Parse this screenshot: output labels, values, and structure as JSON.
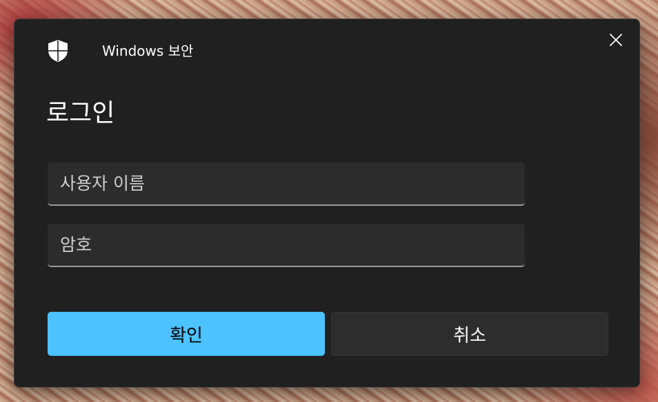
{
  "dialog": {
    "app_title": "Windows 보안",
    "heading": "로그인",
    "fields": {
      "username": {
        "placeholder": "사용자 이름",
        "value": ""
      },
      "password": {
        "placeholder": "암호",
        "value": ""
      }
    },
    "buttons": {
      "ok_label": "확인",
      "cancel_label": "취소"
    },
    "icons": {
      "app": "shield-icon",
      "close": "close-icon"
    }
  },
  "colors": {
    "dialog_bg": "#202020",
    "field_bg": "#2c2c2c",
    "accent": "#4cc2ff",
    "secondary_button": "#2d2d2d",
    "text": "#ffffff"
  }
}
